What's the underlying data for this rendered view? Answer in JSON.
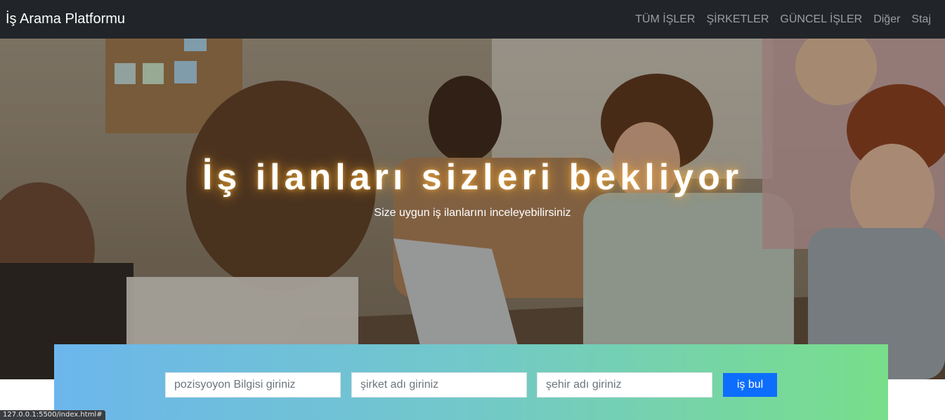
{
  "navbar": {
    "brand": "İş Arama Platformu",
    "links": [
      "TÜM İŞLER",
      "ŞİRKETLER",
      "GÜNCEL İŞLER",
      "Diğer",
      "Staj"
    ]
  },
  "hero": {
    "title": "İş ilanları sizleri bekliyor",
    "subtitle": "Size uygun iş ilanlarını inceleyebilirsiniz",
    "image_alt": "office team meeting photo"
  },
  "search": {
    "position_placeholder": "pozisyoyon Bilgisi giriniz",
    "company_placeholder": "şirket adı giriniz",
    "city_placeholder": "şehir adı giriniz",
    "button_label": "iş bul"
  },
  "status_bar": {
    "url": "127.0.0.1:5500/index.html#"
  },
  "colors": {
    "navbar_bg": "#212529",
    "button_primary": "#0d6efd",
    "gradient_start": "#6cb6ec",
    "gradient_end": "#79de8a"
  }
}
